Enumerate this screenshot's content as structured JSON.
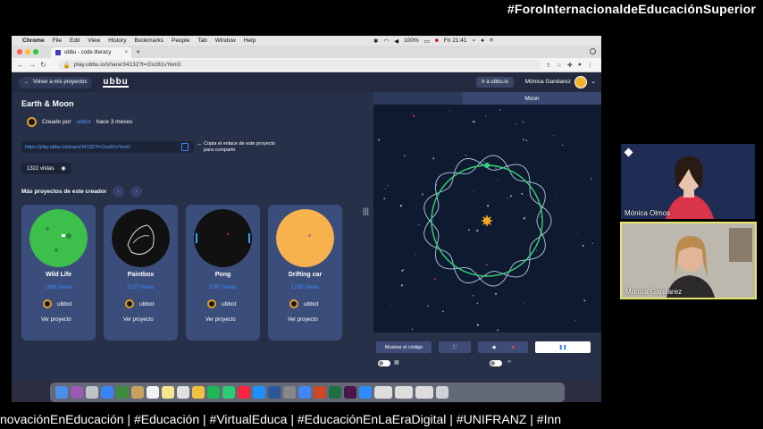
{
  "banner": {
    "hashtag": "#ForoInternacionaldeEducaciónSuperior"
  },
  "menubar": {
    "items": [
      "Chrome",
      "File",
      "Edit",
      "View",
      "History",
      "Bookmarks",
      "People",
      "Tab",
      "Window",
      "Help"
    ],
    "battery": "100%",
    "clock": "Fri 21:41"
  },
  "browser": {
    "tab_title": "ubbu - code literacy",
    "url": "play.ubbu.io/share/34132?t=Oxz81vYenG"
  },
  "app": {
    "back_label": "Volver a mis proyectos",
    "logo": "ubbu",
    "ir_label": "Ir a ubbu.io",
    "user_name": "Mónica Gandarez",
    "project_title": "Earth & Moon",
    "created_by_prefix": "Creado por",
    "creator": "ubbot",
    "created_ago": "hace 3 meses",
    "share_link": "https://play.ubbu.io/share/34132?t=Oxz81vYenG",
    "copy_hint": "Copia el enlace de este proyecto para compartir",
    "views": "1322 vistas",
    "more_title": "Más proyectos de este creador",
    "cards": [
      {
        "name": "Wild Life",
        "views": "1663 Views",
        "user": "ubbot",
        "cta": "Ver proyecto",
        "color": "#3cc04b"
      },
      {
        "name": "Paintbox",
        "views": "2237 Views",
        "user": "ubbot",
        "cta": "Ver proyecto",
        "color": "#111111"
      },
      {
        "name": "Pong",
        "views": "1097 Views",
        "user": "ubbot",
        "cta": "Ver proyecto",
        "color": "#111111"
      },
      {
        "name": "Drifting car",
        "views": "1789 Views",
        "user": "ubbot",
        "cta": "Ver proyecto",
        "color": "#f7b24d"
      }
    ],
    "stage_tabs": [
      "Moon"
    ],
    "show_code": "Mostrar el código"
  },
  "participants": [
    {
      "name": "Mónica Olmos"
    },
    {
      "name": "Monica Gandarez"
    }
  ],
  "ticker": "novaciónEnEducación  |  #Educación  |  #VirtualEduca  |  #EducaciónEnLaEraDigital  |  #UNIFRANZ  |  #Inn"
}
